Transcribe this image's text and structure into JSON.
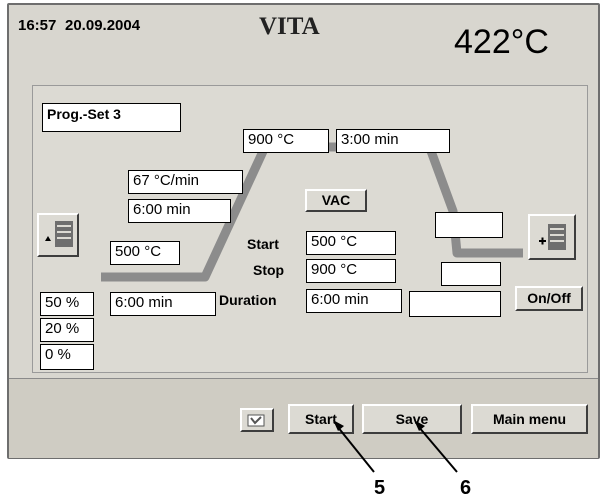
{
  "header": {
    "time": "16:57",
    "date": "20.09.2004",
    "brand": "VITA",
    "current_temp": "422°C"
  },
  "program": {
    "set_name": "Prog.-Set 3",
    "hold_temp": "900 °C",
    "hold_time": "3:00 min",
    "heat_rate": "67 °C/min",
    "heat_time": "6:00 min",
    "start_temp": "500 °C",
    "predry_time": "6:00 min",
    "cool_field_1": "",
    "cool_field_2": "",
    "cool_field_3": ""
  },
  "vac": {
    "button": "VAC",
    "start_label": "Start",
    "start_value": "500 °C",
    "stop_label": "Stop",
    "stop_value": "900 °C",
    "duration_label": "Duration",
    "duration_value": "6:00 min"
  },
  "lift_positions": [
    "50 %",
    "20 %",
    "0 %"
  ],
  "onoff_label": "On/Off",
  "footer": {
    "start": "Start",
    "save": "Save",
    "main_menu": "Main menu"
  },
  "callouts": [
    "5",
    "6"
  ],
  "colors": {
    "curve": "#8c8c8c",
    "background": "#d8d6cf"
  },
  "icons": [
    "lift-up-icon",
    "lift-down-icon",
    "checkbox-icon"
  ]
}
